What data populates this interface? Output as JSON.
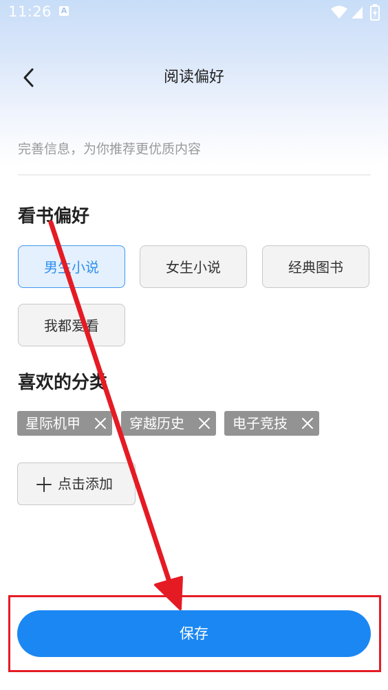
{
  "status_bar": {
    "time": "11:26",
    "indicator": "A"
  },
  "header": {
    "title": "阅读偏好"
  },
  "intro": {
    "text": "完善信息，为你推荐更优质内容"
  },
  "reading_preference": {
    "title": "看书偏好",
    "options": [
      {
        "label": "男生小说",
        "selected": true
      },
      {
        "label": "女生小说",
        "selected": false
      },
      {
        "label": "经典图书",
        "selected": false
      },
      {
        "label": "我都爱看",
        "selected": false
      }
    ]
  },
  "favorite_categories": {
    "title": "喜欢的分类",
    "tags": [
      {
        "label": "星际机甲"
      },
      {
        "label": "穿越历史"
      },
      {
        "label": "电子竞技"
      }
    ],
    "add_label": "点击添加"
  },
  "save": {
    "label": "保存"
  },
  "colors": {
    "accent": "#1b87f2",
    "selected_bg": "#e4f0fd",
    "tag_bg": "#939393",
    "annotation_red": "#e51b24"
  }
}
